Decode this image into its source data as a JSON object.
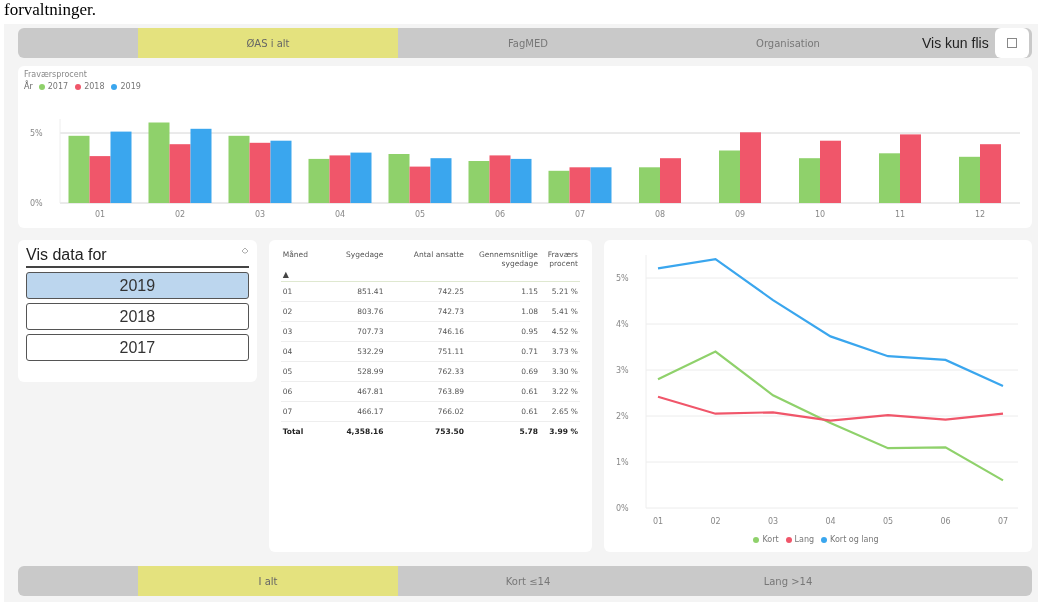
{
  "heading": "forvaltninger.",
  "top_tabs": [
    {
      "label": "ØAS i alt",
      "selected": true
    },
    {
      "label": "FagMED",
      "selected": false
    },
    {
      "label": "Organisation",
      "selected": false
    }
  ],
  "tile_toggle": {
    "label": "Vis kun flis",
    "checked": false
  },
  "bar_chart": {
    "legend_title": "År",
    "chart_data": {
      "type": "bar",
      "title": "Fraværsprocent",
      "categories": [
        "01",
        "02",
        "03",
        "04",
        "05",
        "06",
        "07",
        "08",
        "09",
        "10",
        "11",
        "12"
      ],
      "ylim": [
        0,
        6
      ],
      "grid": true,
      "yticks": [
        {
          "value": 0,
          "label": "0%"
        },
        {
          "value": 5,
          "label": "5%"
        }
      ],
      "series": [
        {
          "name": "2017",
          "color": "#8fd16b",
          "values": [
            4.8,
            5.75,
            4.8,
            3.15,
            3.5,
            3.0,
            2.3,
            2.55,
            3.75,
            3.2,
            3.55,
            3.3
          ]
        },
        {
          "name": "2018",
          "color": "#f0566a",
          "values": [
            3.35,
            4.2,
            4.3,
            3.4,
            2.6,
            3.4,
            2.55,
            3.2,
            5.05,
            4.45,
            4.9,
            4.2
          ]
        },
        {
          "name": "2019",
          "color": "#3aa6ee",
          "values": [
            5.1,
            5.3,
            4.45,
            3.6,
            3.2,
            3.15,
            2.55,
            null,
            null,
            null,
            null,
            null
          ]
        }
      ]
    }
  },
  "slicer": {
    "title": "Vis data for",
    "items": [
      {
        "label": "2019",
        "selected": true
      },
      {
        "label": "2018",
        "selected": false
      },
      {
        "label": "2017",
        "selected": false
      }
    ]
  },
  "table": {
    "columns": [
      "Måned",
      "Sygedage",
      "Antal ansatte",
      "Gennemsnitlige sygedage",
      "Fraværs procent"
    ],
    "sort_indicator": "▲",
    "rows": [
      [
        "01",
        "851.41",
        "742.25",
        "1.15",
        "5.21 %"
      ],
      [
        "02",
        "803.76",
        "742.73",
        "1.08",
        "5.41 %"
      ],
      [
        "03",
        "707.73",
        "746.16",
        "0.95",
        "4.52 %"
      ],
      [
        "04",
        "532.29",
        "751.11",
        "0.71",
        "3.73 %"
      ],
      [
        "05",
        "528.99",
        "762.33",
        "0.69",
        "3.30 %"
      ],
      [
        "06",
        "467.81",
        "763.89",
        "0.61",
        "3.22 %"
      ],
      [
        "07",
        "466.17",
        "766.02",
        "0.61",
        "2.65 %"
      ]
    ],
    "total": [
      "Total",
      "4,358.16",
      "753.50",
      "5.78",
      "3.99 %"
    ]
  },
  "line_chart": {
    "chart_data": {
      "type": "line",
      "categories": [
        "01",
        "02",
        "03",
        "04",
        "05",
        "06",
        "07"
      ],
      "ylim": [
        0,
        5.5
      ],
      "grid": true,
      "yticks": [
        {
          "value": 0,
          "label": "0%"
        },
        {
          "value": 1,
          "label": "1%"
        },
        {
          "value": 2,
          "label": "2%"
        },
        {
          "value": 3,
          "label": "3%"
        },
        {
          "value": 4,
          "label": "4%"
        },
        {
          "value": 5,
          "label": "5%"
        }
      ],
      "series": [
        {
          "name": "Kort",
          "color": "#8fd16b",
          "values": [
            2.8,
            3.4,
            2.45,
            1.85,
            1.3,
            1.32,
            0.6
          ]
        },
        {
          "name": "Lang",
          "color": "#f0566a",
          "values": [
            2.42,
            2.05,
            2.08,
            1.9,
            2.02,
            1.92,
            2.05
          ]
        },
        {
          "name": "Kort og lang",
          "color": "#3aa6ee",
          "values": [
            5.21,
            5.41,
            4.52,
            3.73,
            3.3,
            3.22,
            2.65
          ]
        }
      ]
    }
  },
  "bottom_tabs": [
    {
      "label": "I alt",
      "selected": true
    },
    {
      "label": "Kort ≤14",
      "selected": false
    },
    {
      "label": "Lang >14",
      "selected": false
    }
  ]
}
